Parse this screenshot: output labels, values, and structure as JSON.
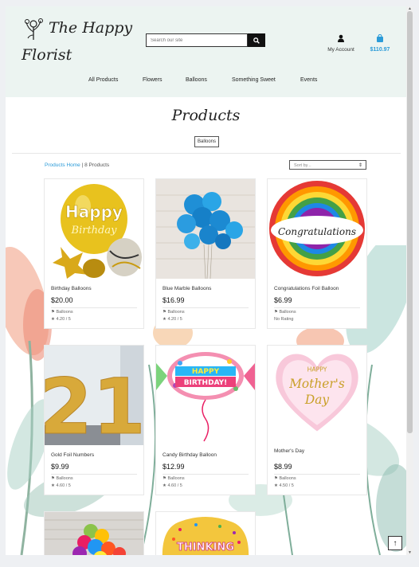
{
  "brand": {
    "line1": "The Happy",
    "line2": "Florist"
  },
  "search": {
    "placeholder": "Search our site"
  },
  "account": {
    "label": "My Account"
  },
  "cart": {
    "total": "$110.97"
  },
  "nav": [
    "All Products",
    "Flowers",
    "Balloons",
    "Something Sweet",
    "Events"
  ],
  "page": {
    "title": "Products",
    "filter_badge": "Balloons"
  },
  "breadcrumb": {
    "home": "Products Home",
    "sep": " | ",
    "count": "8 Products"
  },
  "sort": {
    "selected": "Sort by..."
  },
  "products": [
    {
      "name": "Birthday Balloons",
      "price": "$20.00",
      "category": "Balloons",
      "rating": "4.20 / 5"
    },
    {
      "name": "Blue Marble Balloons",
      "price": "$16.99",
      "category": "Balloons",
      "rating": "4.20 / 5"
    },
    {
      "name": "Congratulations Foil Balloon",
      "price": "$6.99",
      "category": "Balloons",
      "rating": "No Rating"
    },
    {
      "name": "Gold Foil Numbers",
      "price": "$9.99",
      "category": "Balloons",
      "rating": "4.60 / 5"
    },
    {
      "name": "Candy Birthday Balloon",
      "price": "$12.99",
      "category": "Balloons",
      "rating": "4.60 / 5"
    },
    {
      "name": "Mother's Day",
      "price": "$8.99",
      "category": "Balloons",
      "rating": "4.50 / 5"
    }
  ],
  "image_text": {
    "happy": "Happy",
    "birthday": "Birthday",
    "congrats": "Congratulations",
    "number": "21",
    "candy_happy": "HAPPY",
    "candy_birthday": "BIRTHDAY!",
    "md_happy": "HAPPY",
    "md_mothers": "Mother's",
    "md_day": "Day",
    "thinking": "THINKING"
  },
  "colors": {
    "header_bg": "#ecf4f1",
    "link": "#2b9bd8",
    "cart": "#2b9bd8"
  },
  "icons": [
    "flower-logo-icon",
    "search-icon",
    "user-icon",
    "shopping-bag-icon",
    "tag-icon",
    "star-icon",
    "arrow-up-icon"
  ]
}
